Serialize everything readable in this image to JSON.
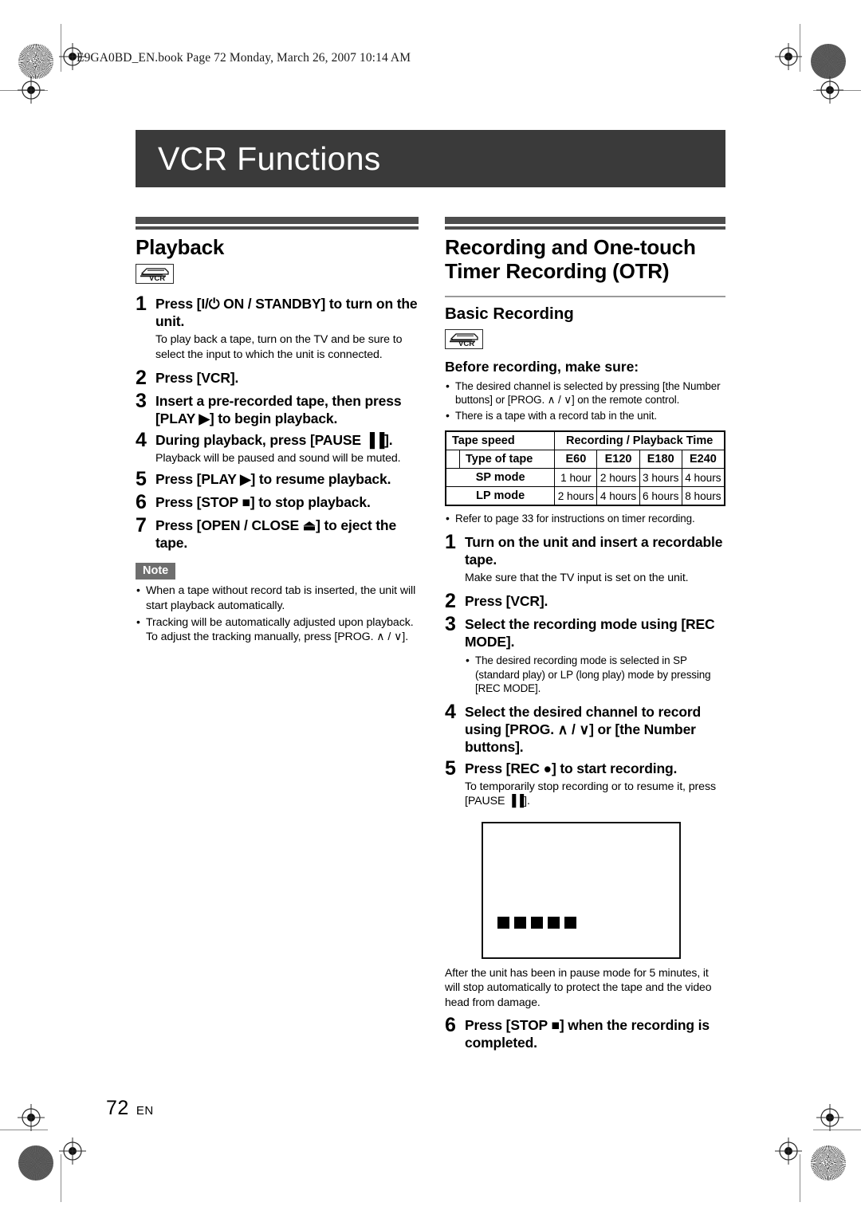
{
  "doc_header": "E9GA0BD_EN.book  Page 72  Monday, March 26, 2007  10:14 AM",
  "title": "VCR Functions",
  "left_column": {
    "heading": "Playback",
    "badge_label": "VCR",
    "steps": [
      {
        "num": "1",
        "head": "Press [I/⏻ ON / STANDBY] to turn on the unit.",
        "sub": "To play back a tape, turn on the TV and be sure to select the input to which the unit is connected."
      },
      {
        "num": "2",
        "head": "Press [VCR].",
        "sub": ""
      },
      {
        "num": "3",
        "head": "Insert a pre-recorded tape, then press [PLAY ▶] to begin playback.",
        "sub": ""
      },
      {
        "num": "4",
        "head": "During playback, press [PAUSE ▐▐].",
        "sub": "Playback will be paused and sound will be muted."
      },
      {
        "num": "5",
        "head": "Press [PLAY ▶] to resume playback.",
        "sub": ""
      },
      {
        "num": "6",
        "head": "Press [STOP ■] to stop playback.",
        "sub": ""
      },
      {
        "num": "7",
        "head": "Press [OPEN / CLOSE ⏏] to eject the tape.",
        "sub": ""
      }
    ],
    "note_tag": "Note",
    "notes": [
      "When a tape without record tab is inserted, the unit will start playback automatically.",
      "Tracking will be automatically adjusted upon playback. To adjust the tracking manually, press [PROG. ∧ / ∨]."
    ]
  },
  "right_column": {
    "heading": "Recording and One-touch Timer Recording (OTR)",
    "sub_heading": "Basic Recording",
    "badge_label": "VCR",
    "before_heading": "Before recording, make sure:",
    "before_bullets": [
      "The desired channel is selected by pressing [the Number buttons] or [PROG. ∧ / ∨] on the remote control.",
      "There is a tape with a record tab in the unit."
    ],
    "refer_note": "Refer to page 33 for instructions on timer recording.",
    "steps": [
      {
        "num": "1",
        "head": "Turn on the unit and insert a recordable tape.",
        "sub": "Make sure that the TV input is set on the unit."
      },
      {
        "num": "2",
        "head": "Press [VCR].",
        "sub": ""
      },
      {
        "num": "3",
        "head": "Select the recording mode using [REC MODE].",
        "sub": ""
      },
      {
        "num": "4",
        "head": "Select the desired channel to record using [PROG. ∧ / ∨] or [the Number buttons].",
        "sub": ""
      },
      {
        "num": "5",
        "head": "Press [REC ●] to start recording.",
        "sub": "To temporarily stop recording or to resume it, press [PAUSE ▐▐]."
      },
      {
        "num": "6",
        "head": "Press [STOP ■] when the recording is completed.",
        "sub": ""
      }
    ],
    "rec_mode_bullet": "The desired recording mode is selected in SP (standard play) or LP (long play) mode by pressing [REC MODE].",
    "pause_caption": "After the unit has been in pause mode for 5 minutes, it will stop automatically to protect the tape and the video head from damage.",
    "screen_squares": 5
  },
  "table": {
    "corner_label": "Tape speed",
    "span_header": "Recording / Playback Time",
    "row_label": "Type of tape",
    "columns": [
      "E60",
      "E120",
      "E180",
      "E240"
    ],
    "rows": [
      {
        "label": "SP mode",
        "values": [
          "1 hour",
          "2 hours",
          "3 hours",
          "4 hours"
        ]
      },
      {
        "label": "LP mode",
        "values": [
          "2 hours",
          "4 hours",
          "6 hours",
          "8 hours"
        ]
      }
    ]
  },
  "footer": {
    "page": "72",
    "lang": "EN"
  }
}
